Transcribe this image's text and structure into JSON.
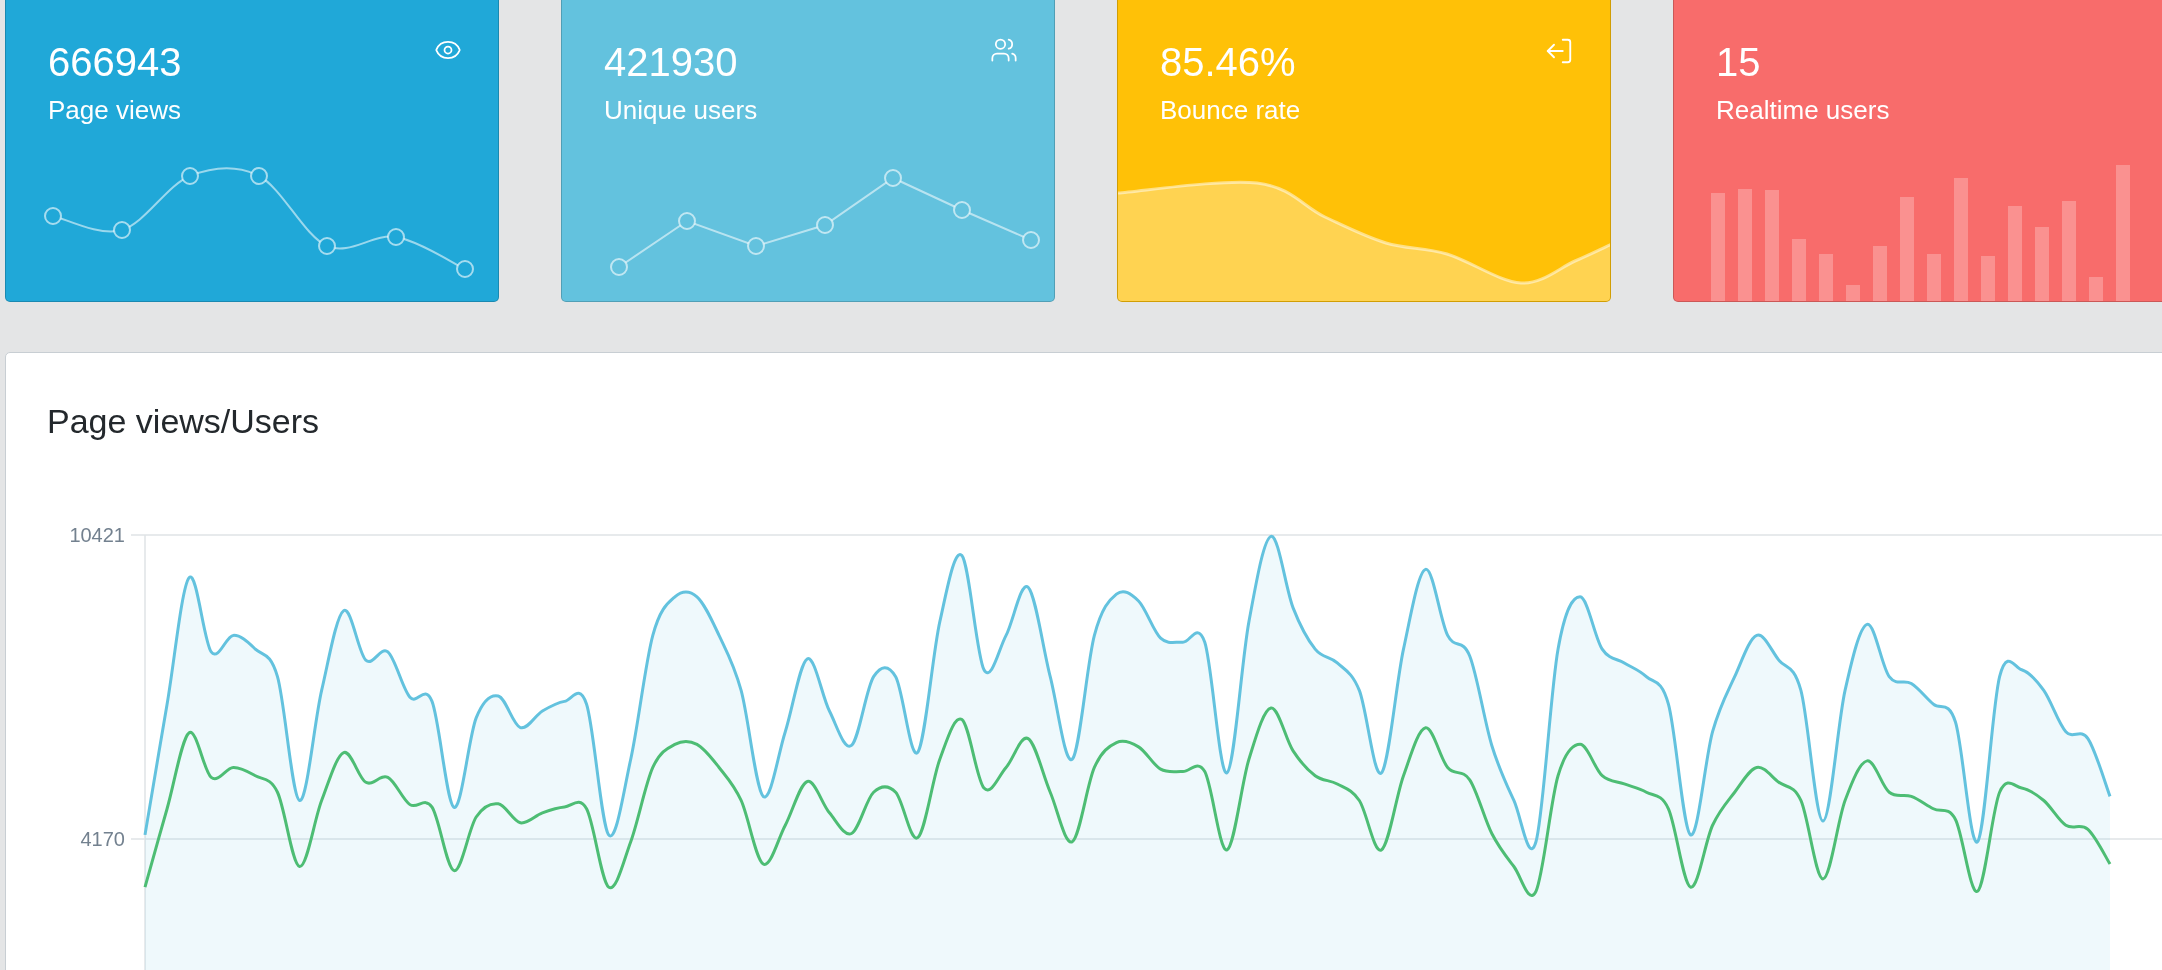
{
  "stat_cards": [
    {
      "kind": "dots",
      "value": "666943",
      "label": "Page views",
      "color": "#20a8d8"
    },
    {
      "kind": "polyline",
      "value": "421930",
      "label": "Unique users",
      "color": "#63c2de"
    },
    {
      "kind": "area",
      "value": "85.46%",
      "label": "Bounce rate",
      "color": "#ffc107"
    },
    {
      "kind": "bars",
      "value": "15",
      "label": "Realtime users",
      "color": "#f86c6b"
    }
  ],
  "panel": {
    "title": "Page views/Users",
    "chart_data": {
      "type": "line",
      "ylim": [
        1456,
        10421
      ],
      "yticks": [
        4170,
        10421
      ],
      "series": [
        {
          "type": "area",
          "color": "#63c2de",
          "values": [
            4255,
            6942,
            9545,
            8017,
            8357,
            8074,
            7508,
            4962,
            7225,
            8866,
            7848,
            8017,
            7084,
            7000,
            4821,
            6660,
            7112,
            6461,
            6801,
            7000,
            6942,
            4255,
            5811,
            8357,
            9149,
            9149,
            8357,
            7225,
            5047,
            6377,
            7876,
            6801,
            6094,
            7508,
            7508,
            5952,
            8640,
            9998,
            7650,
            8357,
            9347,
            7508,
            5811,
            8357,
            9206,
            9064,
            8300,
            8215,
            8215,
            5528,
            8640,
            10394,
            8923,
            8074,
            7791,
            7225,
            5528,
            8074,
            9715,
            8357,
            7933,
            6094,
            4962,
            4113,
            8074,
            9149,
            8074,
            7791,
            7508,
            6942,
            4255,
            6377,
            7508,
            8357,
            7848,
            7225,
            4538,
            7225,
            8583,
            7508,
            7367,
            6942,
            6575,
            4113,
            7508,
            7650,
            7225,
            6377,
            6235,
            5047
          ]
        },
        {
          "type": "line",
          "color": "#4dbd74",
          "values": [
            3180,
            4792,
            6354,
            5437,
            5641,
            5471,
            5132,
            3604,
            4962,
            5947,
            5336,
            5437,
            4877,
            4827,
            3520,
            4623,
            4894,
            4504,
            4708,
            4827,
            4792,
            3180,
            4114,
            5641,
            6116,
            6116,
            5641,
            4962,
            3655,
            4453,
            5353,
            4708,
            4283,
            5132,
            5132,
            4198,
            5811,
            6626,
            5217,
            5641,
            6235,
            5132,
            4114,
            5641,
            6151,
            6065,
            5607,
            5556,
            5556,
            3944,
            5811,
            6863,
            5981,
            5471,
            5302,
            4962,
            3944,
            5471,
            6456,
            5641,
            5387,
            4283,
            3604,
            3095,
            5471,
            6116,
            5471,
            5302,
            5132,
            4792,
            3180,
            4453,
            5132,
            5641,
            5336,
            4962,
            3350,
            4962,
            5777,
            5132,
            5047,
            4792,
            4572,
            3095,
            5132,
            5217,
            4962,
            4453,
            4368,
            3655
          ]
        }
      ]
    }
  }
}
